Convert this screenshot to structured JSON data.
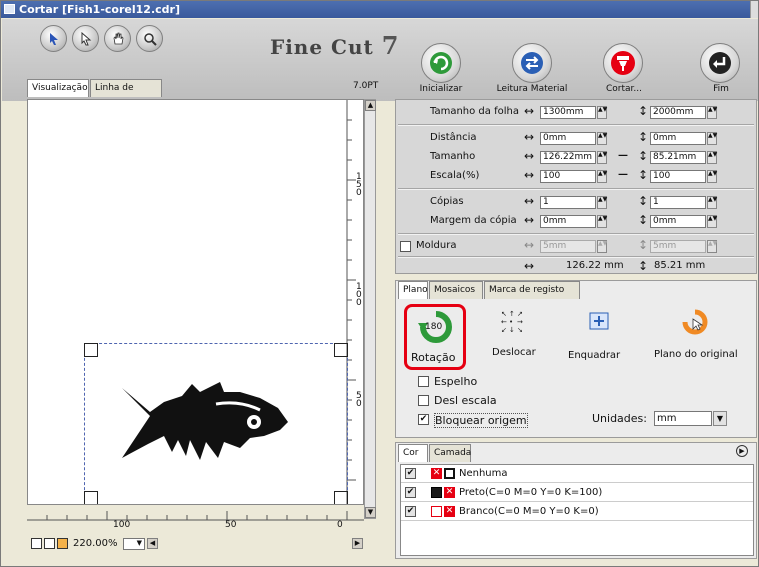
{
  "window": {
    "title": "Cortar [Fish1-corel12.cdr]"
  },
  "logo": {
    "text": "Fine Cut",
    "version": "7"
  },
  "toolbar": {
    "icons": [
      "arrow-icon",
      "select-icon",
      "hand-icon",
      "zoom-icon"
    ],
    "big_buttons": [
      {
        "label": "Inicializar",
        "icon": "refresh-icon"
      },
      {
        "label": "Leitura Material",
        "icon": "swap-icon"
      },
      {
        "label": "Cortar...",
        "icon": "cutter-icon"
      },
      {
        "label": "Fim",
        "icon": "return-icon"
      }
    ]
  },
  "preview": {
    "tabs": [
      "Visualização",
      "Linha de corte"
    ],
    "version_label": "7.0PT",
    "ruler_v": [
      "1",
      "5",
      "0",
      "1",
      "0",
      "0",
      "5",
      "0"
    ],
    "ruler_h": [
      "100",
      "50",
      "0"
    ],
    "zoom": "220.00%"
  },
  "settings": {
    "tamanho_folha": {
      "label": "Tamanho da folha",
      "w": "1300mm",
      "h": "2000mm"
    },
    "distancia": {
      "label": "Distância",
      "w": "0mm",
      "h": "0mm"
    },
    "tamanho": {
      "label": "Tamanho",
      "w": "126.22mm",
      "h": "85.21mm"
    },
    "escala": {
      "label": "Escala(%)",
      "w": "100",
      "h": "100"
    },
    "copias": {
      "label": "Cópias",
      "w": "1",
      "h": "1"
    },
    "margem": {
      "label": "Margem da cópia",
      "w": "0mm",
      "h": "0mm"
    },
    "moldura": {
      "label": "Moldura",
      "w": "5mm",
      "h": "5mm"
    },
    "summary": {
      "w": "126.22 mm",
      "h": "85.21 mm"
    }
  },
  "plan": {
    "tabs": [
      "Plano",
      "Mosaicos",
      "Marca de registo"
    ],
    "buttons": [
      {
        "label": "Rotação",
        "icon": "rotate-180-icon",
        "badge": "180"
      },
      {
        "label": "Deslocar",
        "icon": "move-arrows-icon"
      },
      {
        "label": "Enquadrar",
        "icon": "fit-frame-icon"
      },
      {
        "label": "Plano do original",
        "icon": "reset-layout-icon"
      }
    ],
    "checks": [
      {
        "label": "Espelho",
        "checked": false
      },
      {
        "label": "Desl escala",
        "checked": false
      },
      {
        "label": "Bloquear origem",
        "checked": true
      }
    ],
    "unidades_label": "Unidades:",
    "unidades_value": "mm"
  },
  "colors": {
    "tabs": [
      "Cor",
      "Camada"
    ],
    "rows": [
      {
        "label": "Nenhuma",
        "color": "#000000",
        "checked": true
      },
      {
        "label": "Preto(C=0 M=0 Y=0 K=100)",
        "color": "#1a1a1a",
        "checked": true
      },
      {
        "label": "Branco(C=0 M=0 Y=0 K=0)",
        "color": "#ffffff",
        "checked": true
      }
    ]
  },
  "accent": {
    "highlight": "#e60012",
    "green": "#2e9a3a",
    "orange": "#f08a24"
  }
}
